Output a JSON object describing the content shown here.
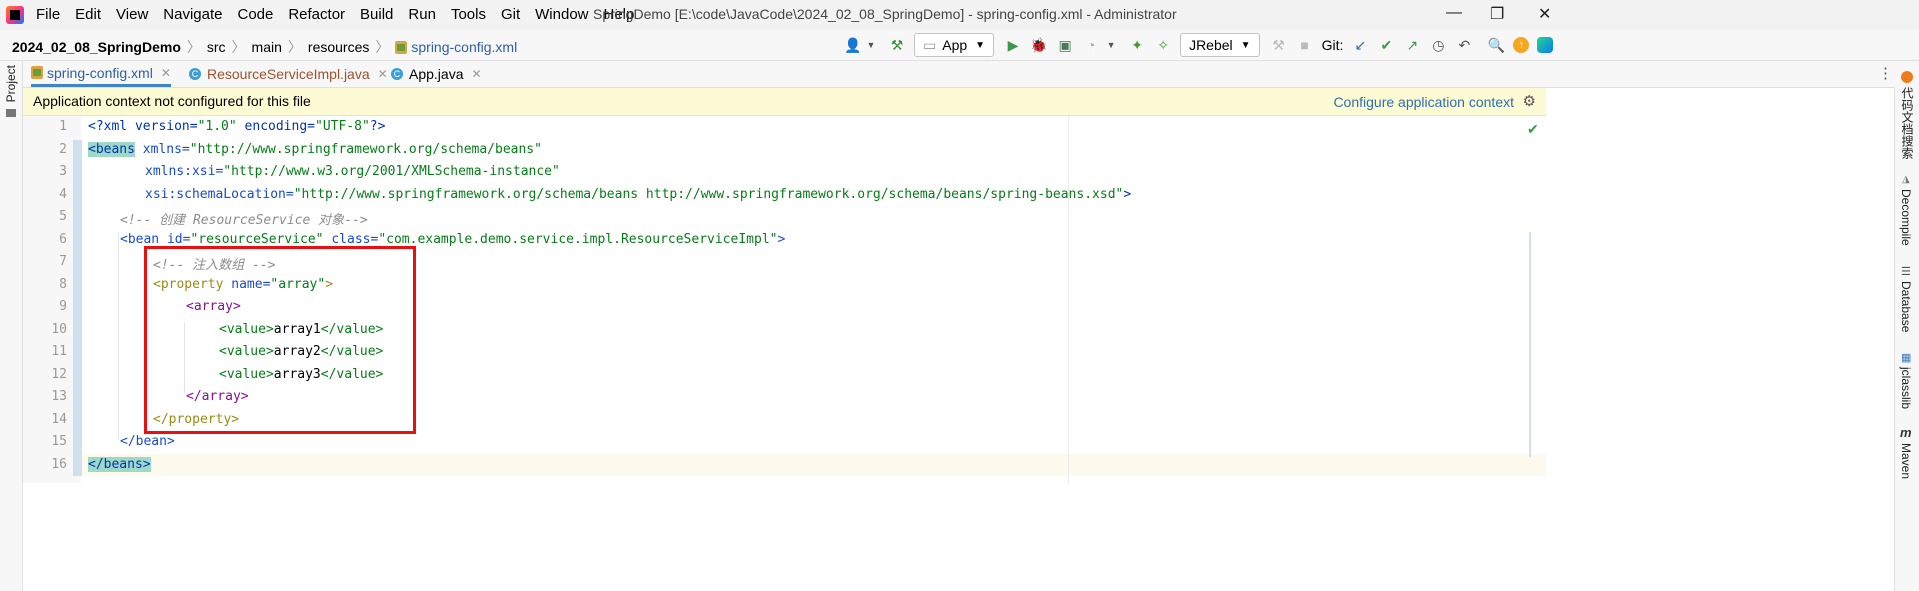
{
  "window": {
    "title": "SpringDemo [E:\\code\\JavaCode\\2024_02_08_SpringDemo] - spring-config.xml - Administrator",
    "menu": [
      "File",
      "Edit",
      "View",
      "Navigate",
      "Code",
      "Refactor",
      "Build",
      "Run",
      "Tools",
      "Git",
      "Window",
      "Help"
    ],
    "controls": {
      "minimize": "—",
      "restore": "❐",
      "close": "✕"
    }
  },
  "breadcrumb": {
    "project": "2024_02_08_SpringDemo",
    "parts": [
      "src",
      "main",
      "resources"
    ],
    "file": "spring-config.xml"
  },
  "toolbar": {
    "run_config": "App",
    "jrebel": "JRebel",
    "git_label": "Git:"
  },
  "side_panels": {
    "left": [
      "Project"
    ],
    "right": [
      "代码文档搜索",
      "Decompile",
      "Database",
      "jclasslib",
      "Maven"
    ]
  },
  "tabs": [
    {
      "label": "spring-config.xml",
      "active": true
    },
    {
      "label": "ResourceServiceImpl.java",
      "active": false
    },
    {
      "label": "App.java",
      "active": false
    }
  ],
  "banner": {
    "message": "Application context not configured for this file",
    "action": "Configure application context"
  },
  "editor": {
    "line_numbers": [
      "1",
      "2",
      "3",
      "4",
      "5",
      "6",
      "7",
      "8",
      "9",
      "10",
      "11",
      "12",
      "13",
      "14",
      "15",
      "16"
    ],
    "code": {
      "l1_a": "<?xml version=",
      "l1_b": "\"1.0\"",
      "l1_c": " encoding=",
      "l1_d": "\"UTF-8\"",
      "l1_e": "?>",
      "l2_tag": "<beans",
      "l2_attr": " xmlns=",
      "l2_val": "\"http://www.springframework.org/schema/beans\"",
      "l3_attr": "xmlns:xsi=",
      "l3_val": "\"http://www.w3.org/2001/XMLSchema-instance\"",
      "l4_attr": "xsi:schemaLocation=",
      "l4_val": "\"http://www.springframework.org/schema/beans http://www.springframework.org/schema/beans/spring-beans.xsd\"",
      "l4_end": ">",
      "l5_cmt": "<!-- 创建 ResourceService 对象-->",
      "l6_tag": "<bean",
      "l6_attr1": " id=",
      "l6_val1": "\"resourceService\"",
      "l6_attr2": " class=",
      "l6_val2": "\"com.example.demo.service.impl.ResourceServiceImpl\"",
      "l6_end": ">",
      "l7_cmt": "<!-- 注入数组 -->",
      "l8_tag": "<property",
      "l8_attr": " name=",
      "l8_val": "\"array\"",
      "l8_end": ">",
      "l9_tag": "<array>",
      "l10_open": "<value>",
      "l10_text": "array1",
      "l10_close": "</value>",
      "l11_open": "<value>",
      "l11_text": "array2",
      "l11_close": "</value>",
      "l12_open": "<value>",
      "l12_text": "array3",
      "l12_close": "</value>",
      "l13_tag": "</array>",
      "l14_tag": "</property>",
      "l15_tag": "</bean>",
      "l16_tag": "</beans>"
    }
  },
  "colors": {
    "tag": "#0033b3",
    "attribute": "#174ad4",
    "value": "#067d17",
    "comment": "#8c8c8c",
    "highlight_box": "#e81010",
    "banner_bg": "#fdfbd3"
  }
}
